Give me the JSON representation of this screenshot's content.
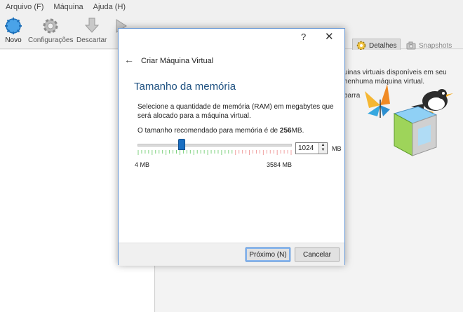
{
  "menu": [
    "Arquivo (F)",
    "Máquina",
    "Ajuda (H)"
  ],
  "toolbar": {
    "novo": "Novo",
    "configuracoes": "Configurações",
    "descartar": "Descartar",
    "iniciar_partial": "Ir"
  },
  "tabs": {
    "detalhes": "Detalhes",
    "snapshots": "Snapshots"
  },
  "welcome": {
    "line1": "uinas virtuais disponíveis em seu",
    "line2": "nenhuma máquina virtual.",
    "line3": "barra"
  },
  "dialog": {
    "help": "?",
    "close": "✕",
    "back": "←",
    "title": "Criar Máquina Virtual",
    "section": "Tamanho da memória",
    "description": "Selecione a quantidade de memória (RAM) em megabytes que será alocado para a máquina virtual.",
    "recommended_prefix": "O tamanho recomendado para memória é de",
    "recommended_value": "256",
    "recommended_suffix": "MB.",
    "slider": {
      "min_label": "4 MB",
      "max_label": "3584 MB",
      "min": 4,
      "max": 3584,
      "value": 1024
    },
    "spin_value": "1024",
    "unit": "MB",
    "next_button": "Próximo (N)",
    "cancel_button": "Cancelar"
  },
  "colors": {
    "accent": "#1e5181",
    "slider_thumb": "#1a6fc2",
    "tick_green": "#7fd27f",
    "tick_red": "#f0a0a0"
  }
}
